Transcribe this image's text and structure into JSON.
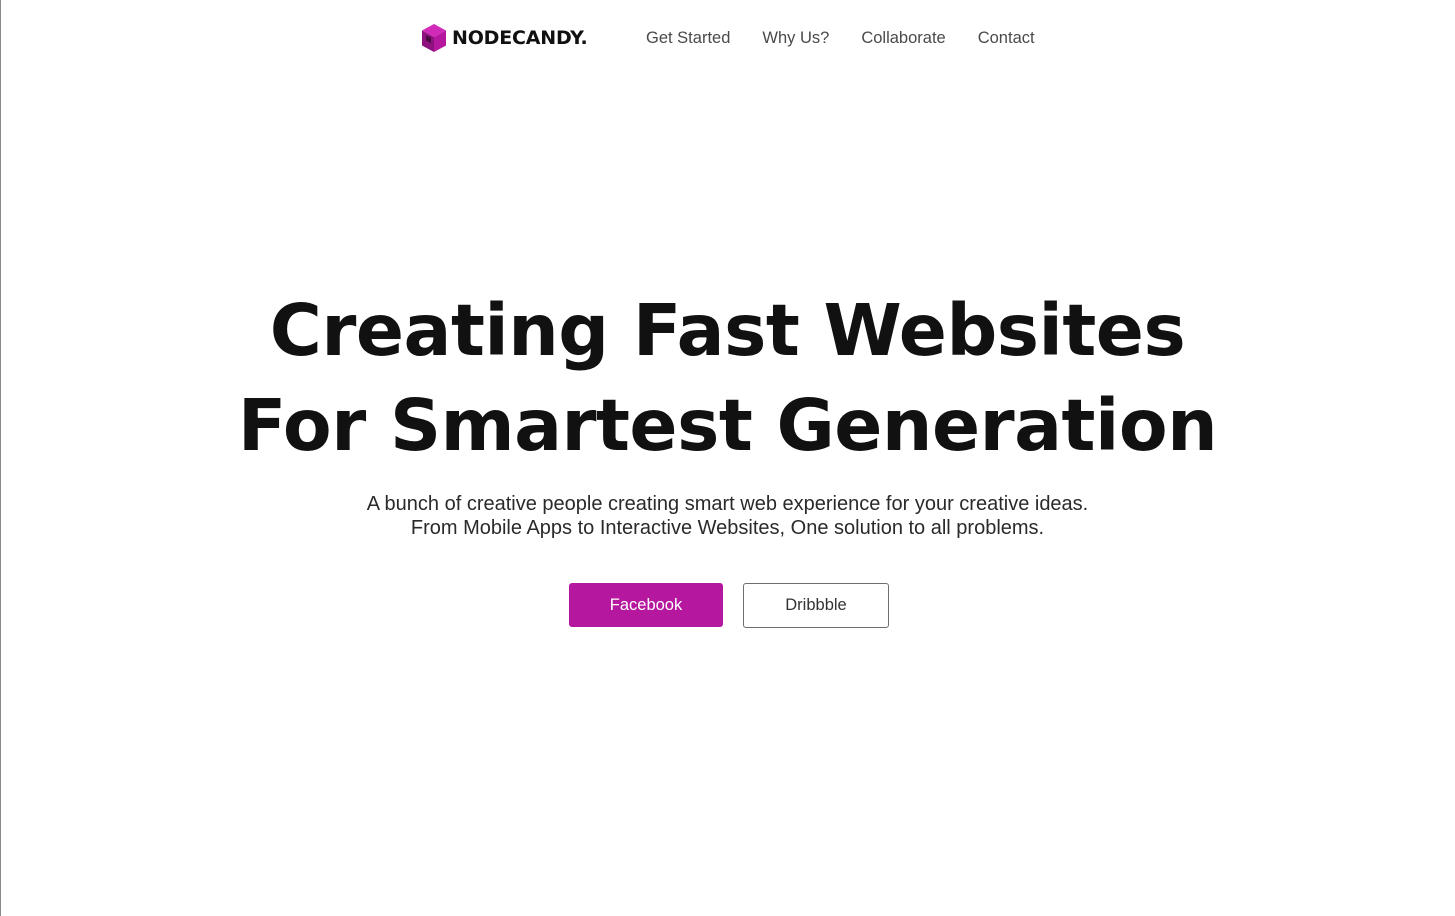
{
  "nav": {
    "logo": {
      "icon": "cube-logo-icon",
      "text": "NODECANDY."
    },
    "links": [
      {
        "label": "Get Started"
      },
      {
        "label": "Why Us?"
      },
      {
        "label": "Collaborate"
      },
      {
        "label": "Contact"
      }
    ]
  },
  "hero": {
    "title_lines": [
      "Creating Fast Websites",
      "For Smartest Generation"
    ],
    "subtitle_lines": [
      "A bunch of creative people creating smart web experience for your creative ideas.",
      "From Mobile Apps to Interactive Websites, One solution to all problems."
    ],
    "buttons": {
      "primary": "Facebook",
      "secondary": "Dribbble"
    }
  },
  "colors": {
    "accent": "#b5179e",
    "logo_dark": "#5b0f52",
    "text": "#111111",
    "nav_text": "#4a4a4a",
    "background": "#ffffff"
  }
}
